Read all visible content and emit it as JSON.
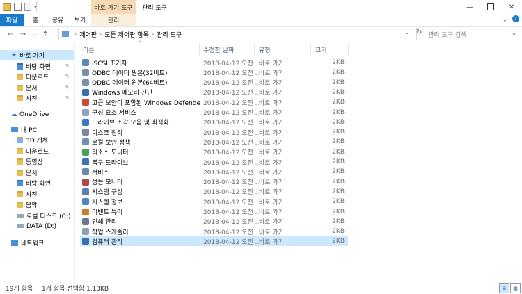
{
  "titlebar": {
    "context_tab": "바로 가기 도구",
    "window_title": "관리 도구"
  },
  "ribbon": {
    "tabs": [
      "파일",
      "홈",
      "공유",
      "보기"
    ],
    "context_sub_tab": "관리"
  },
  "address": {
    "crumbs": [
      "제어판",
      "모든 제어판 항목",
      "관리 도구"
    ],
    "search_placeholder": "관리 도구 검색"
  },
  "nav": {
    "quick_access": "바로 가기",
    "quick_items": [
      "바탕 화면",
      "다운로드",
      "문서",
      "사진"
    ],
    "onedrive": "OneDrive",
    "pc": "내 PC",
    "pc_items": [
      "3D 개체",
      "다운로드",
      "동영상",
      "문서",
      "바탕 화면",
      "사진",
      "음악",
      "로컬 디스크 (C:)",
      "DATA (D:)"
    ],
    "network": "네트워크"
  },
  "list": {
    "headers": {
      "name": "이름",
      "date": "수정한 날짜",
      "type": "유형",
      "size": "크기"
    },
    "rows": [
      {
        "name": "iSCSI 초기자",
        "date": "2018-04-12 오전 ...",
        "type": "바로 가기",
        "size": "2KB"
      },
      {
        "name": "ODBC 데이터 원본(32비트)",
        "date": "2018-04-12 오전 ...",
        "type": "바로 가기",
        "size": "2KB"
      },
      {
        "name": "ODBC 데이터 원본(64비트)",
        "date": "2018-04-12 오전 ...",
        "type": "바로 가기",
        "size": "2KB"
      },
      {
        "name": "Windows 메모리 진단",
        "date": "2018-04-12 오전 ...",
        "type": "바로 가기",
        "size": "2KB"
      },
      {
        "name": "고급 보안이 포함된 Windows Defender ...",
        "date": "2018-04-12 오전 ...",
        "type": "바로 가기",
        "size": "2KB"
      },
      {
        "name": "구성 요소 서비스",
        "date": "2018-04-12 오전 ...",
        "type": "바로 가기",
        "size": "2KB"
      },
      {
        "name": "드라이브 조각 모음 및 최적화",
        "date": "2018-04-12 오전 ...",
        "type": "바로 가기",
        "size": "2KB"
      },
      {
        "name": "디스크 정리",
        "date": "2018-04-12 오전 ...",
        "type": "바로 가기",
        "size": "2KB"
      },
      {
        "name": "로컬 보안 정책",
        "date": "2018-04-12 오전 ...",
        "type": "바로 가기",
        "size": "2KB"
      },
      {
        "name": "리소스 모니터",
        "date": "2018-04-12 오전 ...",
        "type": "바로 가기",
        "size": "2KB"
      },
      {
        "name": "복구 드라이브",
        "date": "2018-04-12 오전 ...",
        "type": "바로 가기",
        "size": "2KB"
      },
      {
        "name": "서비스",
        "date": "2018-04-12 오전 ...",
        "type": "바로 가기",
        "size": "2KB"
      },
      {
        "name": "성능 모니터",
        "date": "2018-04-12 오전 ...",
        "type": "바로 가기",
        "size": "2KB"
      },
      {
        "name": "시스템 구성",
        "date": "2018-04-12 오전 ...",
        "type": "바로 가기",
        "size": "2KB"
      },
      {
        "name": "시스템 정보",
        "date": "2018-04-12 오전 ...",
        "type": "바로 가기",
        "size": "2KB"
      },
      {
        "name": "이벤트 뷰어",
        "date": "2018-04-12 오전 ...",
        "type": "바로 가기",
        "size": "2KB"
      },
      {
        "name": "인쇄 관리",
        "date": "2018-04-12 오전 ...",
        "type": "바로 가기",
        "size": "2KB"
      },
      {
        "name": "작업 스케줄러",
        "date": "2018-04-12 오전 ...",
        "type": "바로 가기",
        "size": "2KB"
      },
      {
        "name": "컴퓨터 관리",
        "date": "2018-04-12 오전 ...",
        "type": "바로 가기",
        "size": "2KB"
      }
    ]
  },
  "status": {
    "count": "19개 항목",
    "selected": "1개 항목 선택함 1.13KB"
  },
  "colors": {
    "accent": "#1979ca",
    "selection": "#cce8ff",
    "context_tab": "#f7d9b4"
  }
}
